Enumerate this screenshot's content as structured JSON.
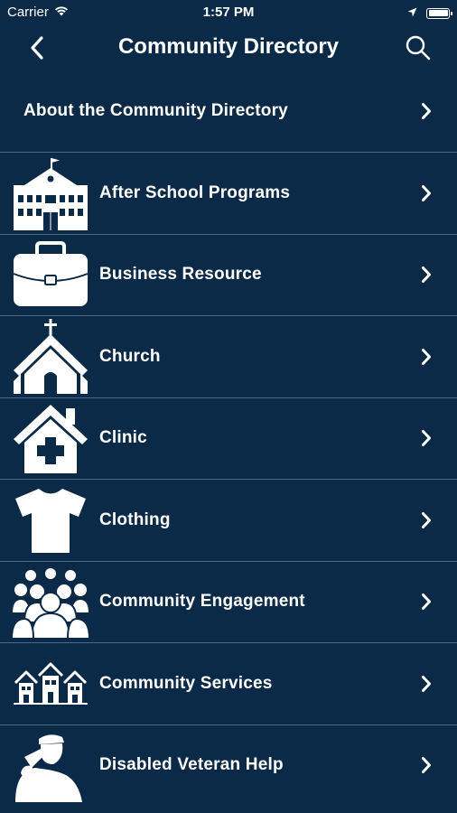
{
  "status_bar": {
    "carrier": "Carrier",
    "time": "1:57 PM"
  },
  "nav": {
    "title": "Community Directory",
    "back_icon": "chevron-left-icon",
    "search_icon": "search-icon"
  },
  "list": {
    "items": [
      {
        "label": "About the Community Directory",
        "icon": ""
      },
      {
        "label": "After School Programs",
        "icon": "school-building-icon"
      },
      {
        "label": "Business Resource",
        "icon": "briefcase-icon"
      },
      {
        "label": "Church",
        "icon": "church-icon"
      },
      {
        "label": "Clinic",
        "icon": "clinic-house-icon"
      },
      {
        "label": "Clothing",
        "icon": "tshirt-icon"
      },
      {
        "label": "Community Engagement",
        "icon": "crowd-icon"
      },
      {
        "label": "Community Services",
        "icon": "houses-icon"
      },
      {
        "label": "Disabled Veteran Help",
        "icon": "saluting-soldier-icon"
      }
    ]
  },
  "colors": {
    "background": "#0b2a47",
    "divider": "#4a6a88",
    "foreground": "#ffffff"
  }
}
